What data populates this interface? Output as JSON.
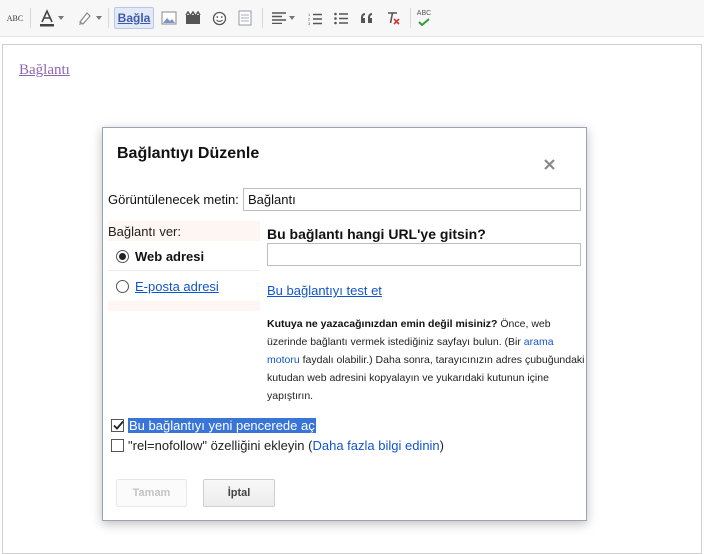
{
  "toolbar": {
    "link_label": "Bağla",
    "spellcheck_label": "ABC",
    "check_label": "ABC"
  },
  "editor": {
    "link_text": "Bağlantı"
  },
  "dialog": {
    "title": "Bağlantıyı Düzenle",
    "display_text_label": "Görüntülenecek metin:",
    "display_text_value": "Bağlantı",
    "link_to_label": "Bağlantı ver:",
    "options": {
      "web": "Web adresi",
      "email": "E-posta adresi"
    },
    "url_question": "Bu bağlantı hangi URL'ye gitsin?",
    "url_value": "",
    "test_link": "Bu bağlantıyı test et",
    "help": {
      "bold": "Kutuya ne yazacağınızdan emin değil misiniz?",
      "part1": " Önce, web üzerinde bağlantı vermek istediğiniz sayfayı bulun. (Bir ",
      "link": "arama motoru",
      "part2": " faydalı olabilir.) Daha sonra, tarayıcınızın adres çubuğundaki kutudan web adresini kopyalayın ve yukarıdaki kutunun içine yapıştırın."
    },
    "new_window_label": "Bu bağlantıyı yeni pencerede aç",
    "nofollow_label": "\"rel=nofollow\" özelliğini ekleyin (",
    "nofollow_link": "Daha fazla bilgi edinin",
    "nofollow_close": ")",
    "ok_button": "Tamam",
    "cancel_button": "İptal"
  }
}
